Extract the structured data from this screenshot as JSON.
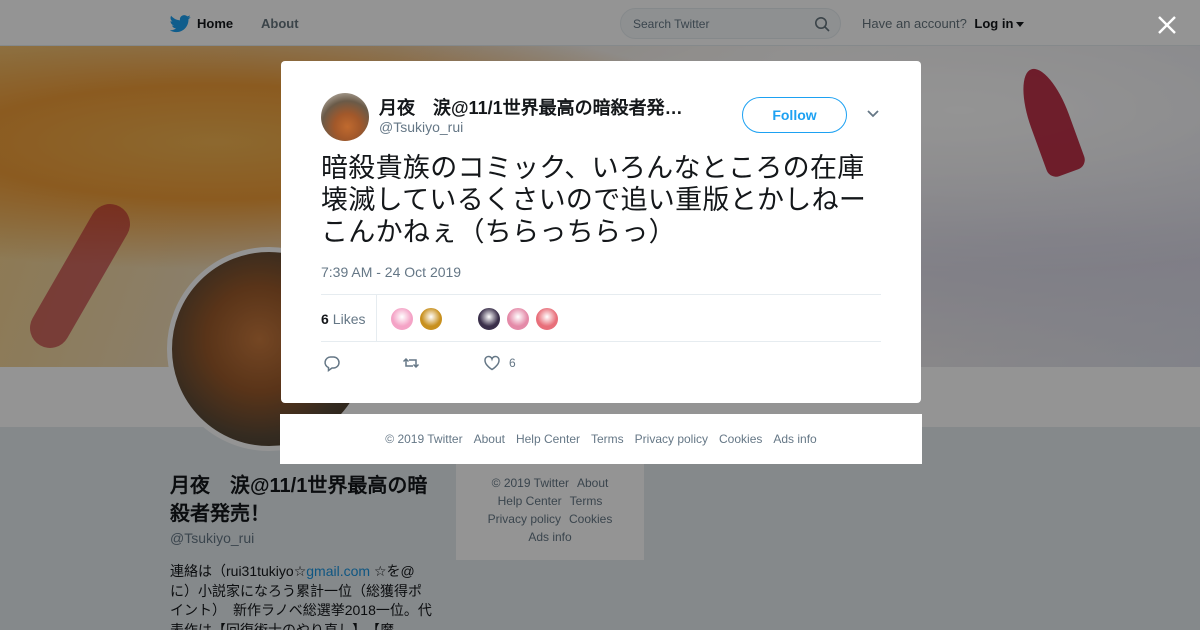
{
  "topbar": {
    "home_label": "Home",
    "about_label": "About",
    "search_placeholder": "Search Twitter",
    "have_account": "Have an account?",
    "login_label": "Log in"
  },
  "profile": {
    "name": "月夜　涙@11/1世界最高の暗殺者発売！",
    "handle": "@Tsukiyo_rui",
    "bio_prefix": "連絡は（rui31tukiyo☆",
    "bio_link": "gmail.com",
    "bio_rest": " ☆を@に）小説家になろう累計一位（総獲得ポイント）　新作ラノベ総選挙2018一位。代表作は【回復術士のやり直し】、【魔"
  },
  "mini_footer": {
    "links": [
      "© 2019 Twitter",
      "About",
      "Help Center",
      "Terms",
      "Privacy policy",
      "Cookies",
      "Ads info"
    ]
  },
  "tweet": {
    "name": "月夜　涙@11/1世界最高の暗殺者発…",
    "handle": "@Tsukiyo_rui",
    "follow_label": "Follow",
    "text": "暗殺貴族のコミック、いろんなところの在庫壊滅しているくさいので追い重版とかしねーこんかねぇ（ちらっちらっ）",
    "timestamp": "7:39 AM - 24 Oct 2019",
    "likes_count": "6",
    "likes_label": "Likes",
    "like_action_count": "6",
    "liker_colors": [
      "#f4a3c6",
      "#c8901e",
      "#ffffff",
      "#3a2f4a",
      "#e48aa8",
      "#e86f7a"
    ]
  },
  "modal_footer": {
    "links": [
      "© 2019 Twitter",
      "About",
      "Help Center",
      "Terms",
      "Privacy policy",
      "Cookies",
      "Ads info"
    ]
  },
  "colors": {
    "accent": "#1da1f2",
    "overlay": "rgba(0,0,0,0.42)"
  }
}
